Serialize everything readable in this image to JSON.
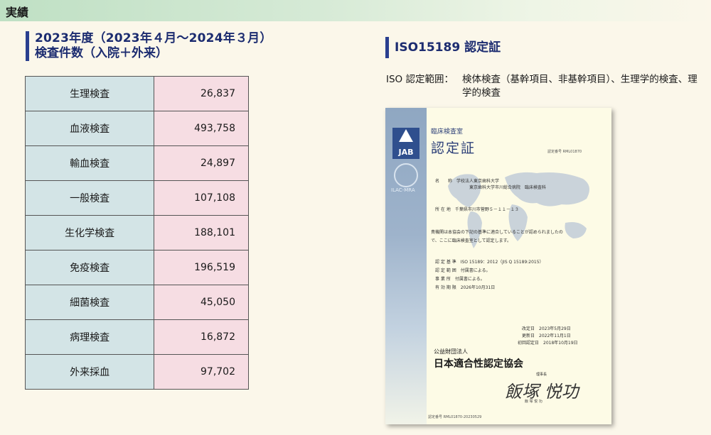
{
  "section": {
    "title": "実績"
  },
  "left": {
    "heading_line1": "2023年度（2023年４月～2024年３月）",
    "heading_line2": "検査件数（入院＋外来）",
    "rows": [
      {
        "name": "生理検査",
        "value": "26,837"
      },
      {
        "name": "血液検査",
        "value": "493,758"
      },
      {
        "name": "輸血検査",
        "value": "24,897"
      },
      {
        "name": "一般検査",
        "value": "107,108"
      },
      {
        "name": "生化学検査",
        "value": "188,101"
      },
      {
        "name": "免疫検査",
        "value": "196,519"
      },
      {
        "name": "細菌検査",
        "value": "45,050"
      },
      {
        "name": "病理検査",
        "value": "16,872"
      },
      {
        "name": "外来採血",
        "value": "97,702"
      }
    ]
  },
  "right": {
    "heading": "ISO15189 認定証",
    "scope_label": "ISO 認定範囲：",
    "scope_text": "検体検査（基幹項目、非基幹項目）、生理学的検査、理学的検査"
  },
  "certificate": {
    "dept": "臨床検査室",
    "title": "認定証",
    "regno": "認定番号 RML01870",
    "logo_text": "JAB",
    "ilac_text": "ILAC-MRA",
    "line_name": "名　　称　学校法人東京歯科大学",
    "line_name2": "東京歯科大学市川総合病院　臨床検査科",
    "line_addr": "所 在 地　千葉県市川市菅野５－１１－１３",
    "line_body1": "貴機関は本協会の下記の基準に適合していることが認められましたの",
    "line_body2": "で、ここに臨床検査室として認定します。",
    "line_std": "認 定 基 準　ISO 15189：2012（JIS Q 15189:2015）",
    "line_scope": "認 定 範 囲　付属書による。",
    "line_site": "事 業 所　付属書による。",
    "line_valid": "有 効 期 限　2026年10月31日",
    "line_rev": "改定日　2023年5月29日",
    "line_upd": "更新日　2022年11月1日",
    "line_first": "初回認定日　2018年10月19日",
    "org_small": "公益財団法人",
    "org_big": "日本適合性認定協会",
    "chief": "理事長",
    "signature": "飯塚 悦功",
    "signame": "飯 塚 悦 功",
    "footer": "認定番号 RML01870-20230529"
  }
}
